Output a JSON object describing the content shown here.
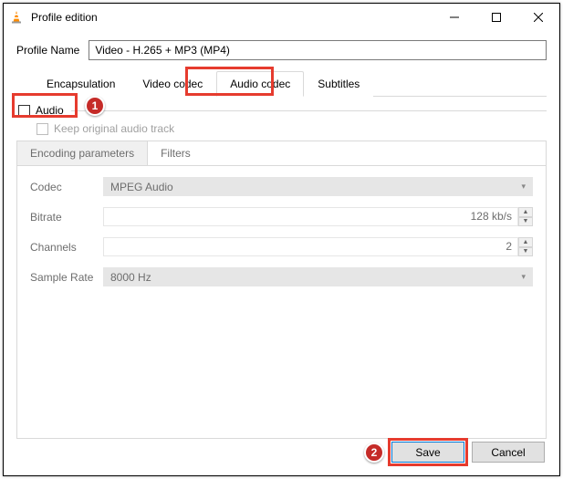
{
  "window": {
    "title": "Profile edition"
  },
  "profile": {
    "name_label": "Profile Name",
    "name_value": "Video - H.265 + MP3 (MP4)"
  },
  "tabs": {
    "encapsulation": "Encapsulation",
    "video_codec": "Video codec",
    "audio_codec": "Audio codec",
    "subtitles": "Subtitles",
    "active": "audio_codec"
  },
  "audio": {
    "checkbox_label": "Audio",
    "checked": false,
    "keep_original": "Keep original audio track",
    "keep_original_checked": false,
    "sub_tabs": {
      "encoding": "Encoding parameters",
      "filters": "Filters",
      "active": "encoding"
    },
    "params": {
      "codec_label": "Codec",
      "codec_value": "MPEG Audio",
      "bitrate_label": "Bitrate",
      "bitrate_value": "128 kb/s",
      "channels_label": "Channels",
      "channels_value": "2",
      "sample_rate_label": "Sample Rate",
      "sample_rate_value": "8000 Hz"
    }
  },
  "footer": {
    "save": "Save",
    "cancel": "Cancel"
  },
  "callouts": {
    "one": "1",
    "two": "2"
  }
}
